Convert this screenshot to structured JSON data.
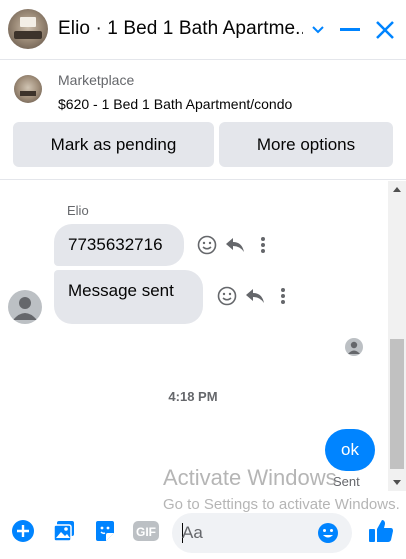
{
  "header": {
    "title": "Elio · 1 Bed 1 Bath Apartme...",
    "accent_color": "#0084ff"
  },
  "listing": {
    "label": "Marketplace",
    "description": "$620 - 1 Bed 1 Bath Apartment/condo",
    "buttons": {
      "mark_pending": "Mark as pending",
      "more_options": "More options"
    }
  },
  "conversation": {
    "sender_name": "Elio",
    "messages": [
      {
        "from": "them",
        "text": "7735632716"
      },
      {
        "from": "them",
        "text": "Message sent"
      },
      {
        "from": "me",
        "text": "ok"
      }
    ],
    "timestamp": "4:18 PM",
    "status": "Sent"
  },
  "watermark": {
    "title": "Activate Windows",
    "subtitle": "Go to Settings to activate Windows."
  },
  "composer": {
    "placeholder": "Aa",
    "gif_label": "GIF"
  }
}
